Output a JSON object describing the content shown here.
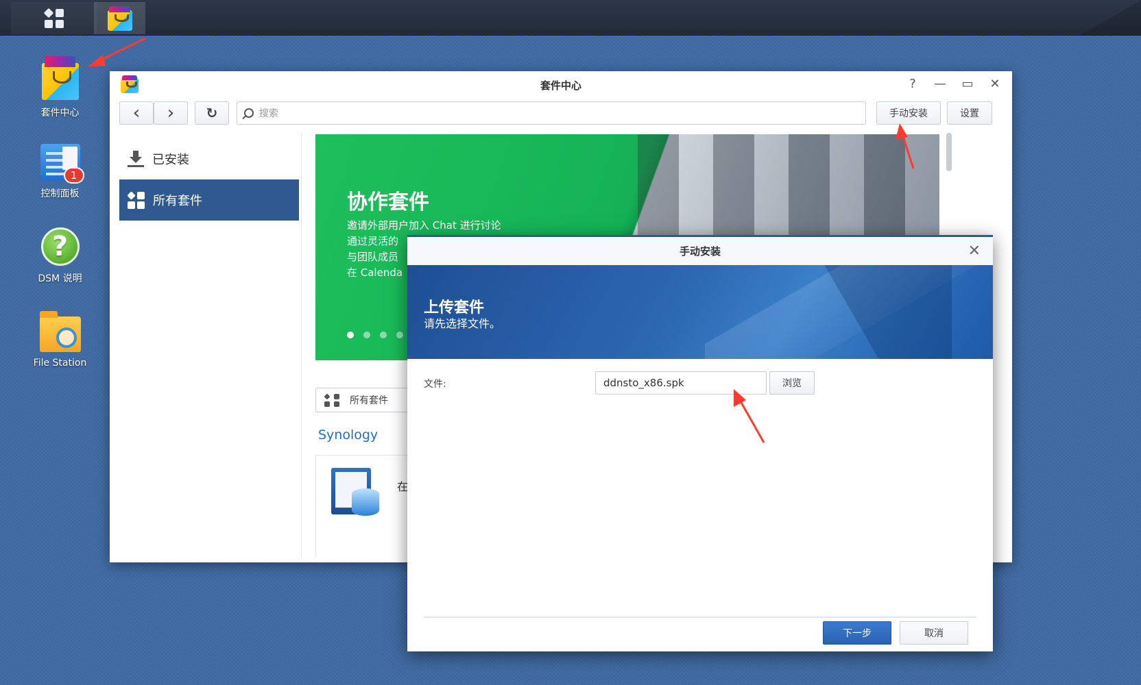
{
  "taskbar": {
    "items": [
      {
        "name": "main-menu",
        "icon": "grid-icon"
      },
      {
        "name": "package-center",
        "icon": "package-bag-icon",
        "active": true
      }
    ]
  },
  "desktop": {
    "icons": [
      {
        "label": "套件中心",
        "icon": "package-bag-icon"
      },
      {
        "label": "控制面板",
        "icon": "control-panel-icon",
        "badge": "1"
      },
      {
        "label": "DSM 说明",
        "icon": "help-icon",
        "glyph": "?"
      },
      {
        "label": "File Station",
        "icon": "folder-search-icon"
      }
    ]
  },
  "window": {
    "title": "套件中心",
    "controls": {
      "help": "?",
      "minimize": "—",
      "maximize": "▭",
      "close": "✕"
    },
    "toolbar": {
      "back": "‹",
      "forward": "›",
      "refresh": "↻",
      "search_placeholder": "搜索",
      "manual_install": "手动安装",
      "settings": "设置"
    },
    "sidebar": {
      "items": [
        {
          "label": "已安装",
          "selected": false
        },
        {
          "label": "所有套件",
          "selected": true
        }
      ]
    },
    "banner": {
      "title": "协作套件",
      "lines": [
        "邀请外部用户加入 Chat 进行讨论",
        "通过灵活的",
        "与团队成员",
        "在 Calenda"
      ]
    },
    "filter_label": "所有套件",
    "section_title": "Synology",
    "package_partial_text": "在"
  },
  "dialog": {
    "title": "手动安装",
    "close": "✕",
    "heading": "上传套件",
    "subheading": "请先选择文件。",
    "file_label": "文件:",
    "file_value": "ddnsto_x86.spk",
    "browse": "浏览",
    "next": "下一步",
    "cancel": "取消"
  },
  "colors": {
    "desktop_bg": "#3f6aa3",
    "taskbar_bg": "#2c3748",
    "selected_sidebar": "#2f5a8f",
    "banner_green": "#1fbf5c",
    "primary_button": "#2b63b0",
    "annotation_arrow": "#ff3b30"
  }
}
